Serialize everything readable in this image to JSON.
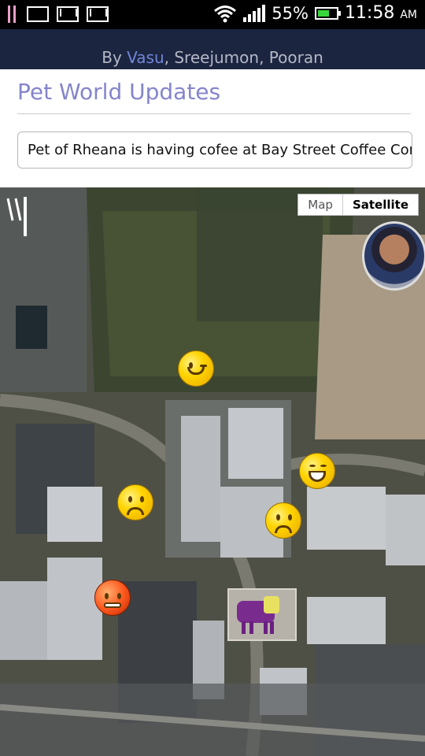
{
  "status_bar": {
    "battery": "55%",
    "time": "11:58",
    "ampm": "AM",
    "icons": [
      "notification-bars-icon",
      "keyboard-icon",
      "gmail-icon",
      "gmail-icon",
      "wifi-icon",
      "signal-icon",
      "battery-icon"
    ],
    "battery_color": "#37d63a"
  },
  "header": {
    "by_prefix": "By",
    "author_1": "Vasu",
    "author_rest": ", Sreejumon, Pooran",
    "title": "Pet World Updates",
    "update_text": "Pet of Rheana is  having cofee at Bay Street Coffee Con",
    "title_color": "#8585cc",
    "header_color": "#1c2540"
  },
  "map": {
    "map_label": "Map",
    "satellite_label": "Satellite",
    "selected": "Satellite",
    "markers": [
      "wink-emoji-icon",
      "laughing-emoji-icon",
      "crying-emoji-icon",
      "sad-emoji-icon",
      "angry-emoji-icon",
      "pet-photo-marker",
      "user-avatar-marker"
    ]
  }
}
